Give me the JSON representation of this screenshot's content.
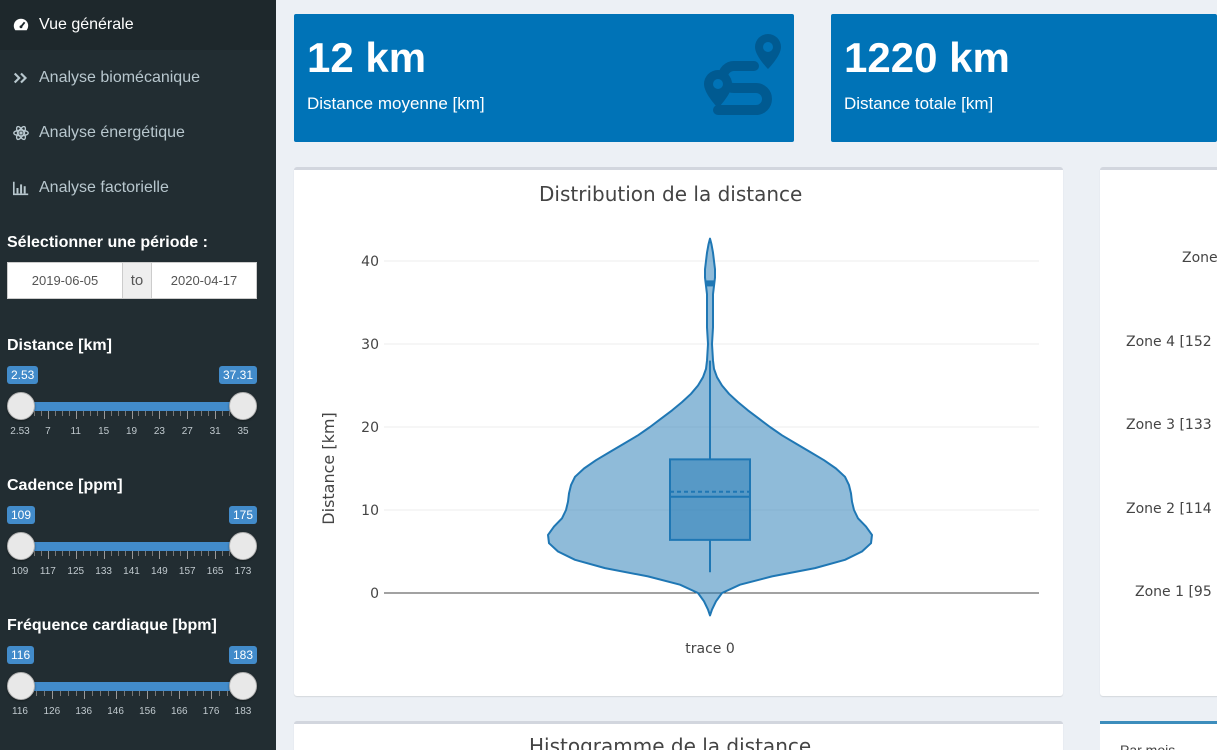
{
  "sidebar": {
    "menu": [
      {
        "label": "Vue générale",
        "icon": "dashboard-icon",
        "active": true
      },
      {
        "label": "Analyse biomécanique",
        "icon": "double-chevron-icon"
      },
      {
        "label": "Analyse énergétique",
        "icon": "atom-icon"
      },
      {
        "label": "Analyse factorielle",
        "icon": "bar-chart-icon"
      }
    ],
    "period": {
      "label": "Sélectionner une période :",
      "start": "2019-06-05",
      "separator": "to",
      "end": "2020-04-17"
    },
    "sliders": [
      {
        "label": "Distance [km]",
        "min_value": "2.53",
        "max_value": "37.31",
        "ticks": [
          "2.53",
          "7",
          "11",
          "15",
          "19",
          "23",
          "27",
          "31",
          "35"
        ]
      },
      {
        "label": "Cadence [ppm]",
        "min_value": "109",
        "max_value": "175",
        "ticks": [
          "109",
          "117",
          "125",
          "133",
          "141",
          "149",
          "157",
          "165",
          "173"
        ]
      },
      {
        "label": "Fréquence cardiaque [bpm]",
        "min_value": "116",
        "max_value": "183",
        "ticks": [
          "116",
          "126",
          "136",
          "146",
          "156",
          "166",
          "176",
          "183"
        ]
      }
    ]
  },
  "value_boxes": [
    {
      "value": "12 km",
      "label": "Distance moyenne [km]",
      "icon": "route-icon"
    },
    {
      "value": "1220 km",
      "label": "Distance totale [km]"
    }
  ],
  "chart_data": {
    "type": "violin",
    "title": "Distribution de la distance",
    "ylabel": "Distance [km]",
    "xlabel": "trace 0",
    "ylim": [
      -3,
      44
    ],
    "yticks": [
      0,
      10,
      20,
      30,
      40
    ],
    "box": {
      "min": 2.5,
      "q1": 6.4,
      "median": 11.6,
      "mean": 12.2,
      "q3": 16.1,
      "max": 28,
      "outlier": 37.3
    },
    "color": "#1f77b4"
  },
  "zones_panel": {
    "labels": [
      "Zone",
      "Zone 4 [152",
      "Zone 3 [133",
      "Zone 2 [114",
      "Zone 1 [95"
    ]
  },
  "histogram": {
    "title": "Histogramme de la distance"
  },
  "tabs": {
    "first": "Par mois"
  },
  "colors": {
    "sidebar": "#222d32",
    "value_box": "#0073b7",
    "accent": "#428bca"
  }
}
